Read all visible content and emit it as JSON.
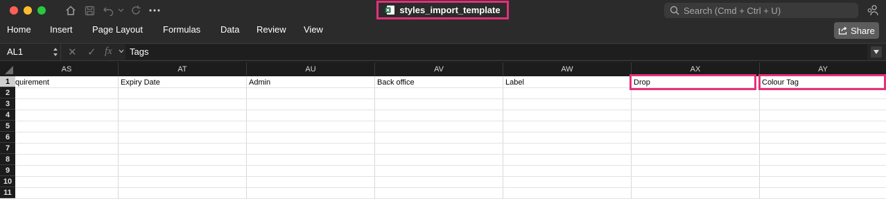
{
  "window": {
    "title": "styles_import_template",
    "search_placeholder": "Search (Cmd + Ctrl + U)"
  },
  "ribbon": {
    "tabs": [
      "Home",
      "Insert",
      "Page Layout",
      "Formulas",
      "Data",
      "Review",
      "View"
    ],
    "share_label": "Share"
  },
  "formula_bar": {
    "cell_ref": "AL1",
    "fx_label": "fx",
    "formula": "Tags"
  },
  "sheet": {
    "columns": [
      "AS",
      "AT",
      "AU",
      "AV",
      "AW",
      "AX",
      "AY"
    ],
    "rows": [
      "1",
      "2",
      "3",
      "4",
      "5",
      "6",
      "7",
      "8",
      "9",
      "10",
      "11"
    ],
    "row1": [
      "quirement",
      "Expiry Date",
      "Admin",
      "Back office",
      "Label",
      "Drop",
      "Colour Tag"
    ]
  },
  "colors": {
    "highlight": "#e5307a",
    "excel_green": "#1d7044"
  }
}
